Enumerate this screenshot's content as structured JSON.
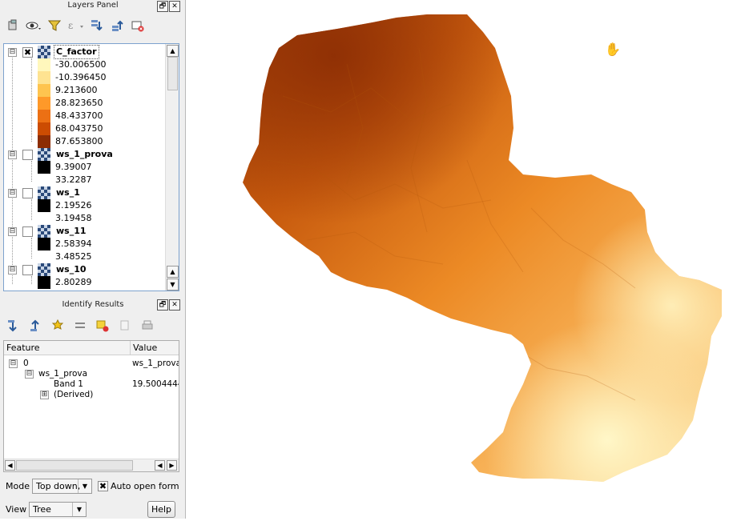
{
  "layers_panel": {
    "title": "Layers Panel",
    "float_button": "🗗",
    "close_button": "✕",
    "layers": [
      {
        "name": "C_factor",
        "checked": true,
        "check_mark": "✖",
        "expanded": true,
        "legend": [
          {
            "label": "-30.006500",
            "color": "#fff7bc"
          },
          {
            "label": "-10.396450",
            "color": "#fee391"
          },
          {
            "label": "9.213600",
            "color": "#fec44f"
          },
          {
            "label": "28.823650",
            "color": "#fe9929"
          },
          {
            "label": "48.433700",
            "color": "#ec7014"
          },
          {
            "label": "68.043750",
            "color": "#cc4c02"
          },
          {
            "label": "87.653800",
            "color": "#8c2d04"
          }
        ]
      },
      {
        "name": "ws_1_prova",
        "checked": false,
        "expanded": true,
        "legend": [
          {
            "label": "9.39007",
            "color": "#000000"
          },
          {
            "label": "33.2287",
            "color": "#ffffff"
          }
        ]
      },
      {
        "name": "ws_1",
        "checked": false,
        "expanded": true,
        "legend": [
          {
            "label": "2.19526",
            "color": "#000000"
          },
          {
            "label": "3.19458",
            "color": "#ffffff"
          }
        ]
      },
      {
        "name": "ws_11",
        "checked": false,
        "expanded": true,
        "legend": [
          {
            "label": "2.58394",
            "color": "#000000"
          },
          {
            "label": "3.48525",
            "color": "#ffffff"
          }
        ]
      },
      {
        "name": "ws_10",
        "checked": false,
        "expanded": true,
        "legend": [
          {
            "label": "2.80289",
            "color": "#000000"
          }
        ]
      }
    ]
  },
  "identify_results": {
    "title": "Identify Results",
    "float_button": "🗗",
    "close_button": "✕",
    "columns": [
      "Feature",
      "Value"
    ],
    "rows": [
      {
        "feature": "0",
        "value": "ws_1_prova"
      },
      {
        "feature": "ws_1_prova",
        "value": ""
      },
      {
        "feature": "Band 1",
        "value": "19.5004444"
      },
      {
        "feature": "(Derived)",
        "value": ""
      }
    ],
    "mode_label": "Mode",
    "mode_value": "Top down,",
    "auto_open_form_label": "Auto open form",
    "auto_open_form_checked": true,
    "auto_open_form_mark": "✖",
    "view_label": "View",
    "view_value": "Tree",
    "help_button": "Help"
  },
  "icons": {
    "expander": "⊟",
    "collapsed": "⊞",
    "dropdown": "▼",
    "scroll_up": "▲",
    "scroll_down": "▼",
    "scroll_left": "◀",
    "scroll_right": "▶",
    "pan_cursor": "✋"
  },
  "map_colors": {
    "dark": "#a63d06",
    "mid": "#e07a1c",
    "light": "#f6a94a",
    "pale": "#fde5a8"
  }
}
